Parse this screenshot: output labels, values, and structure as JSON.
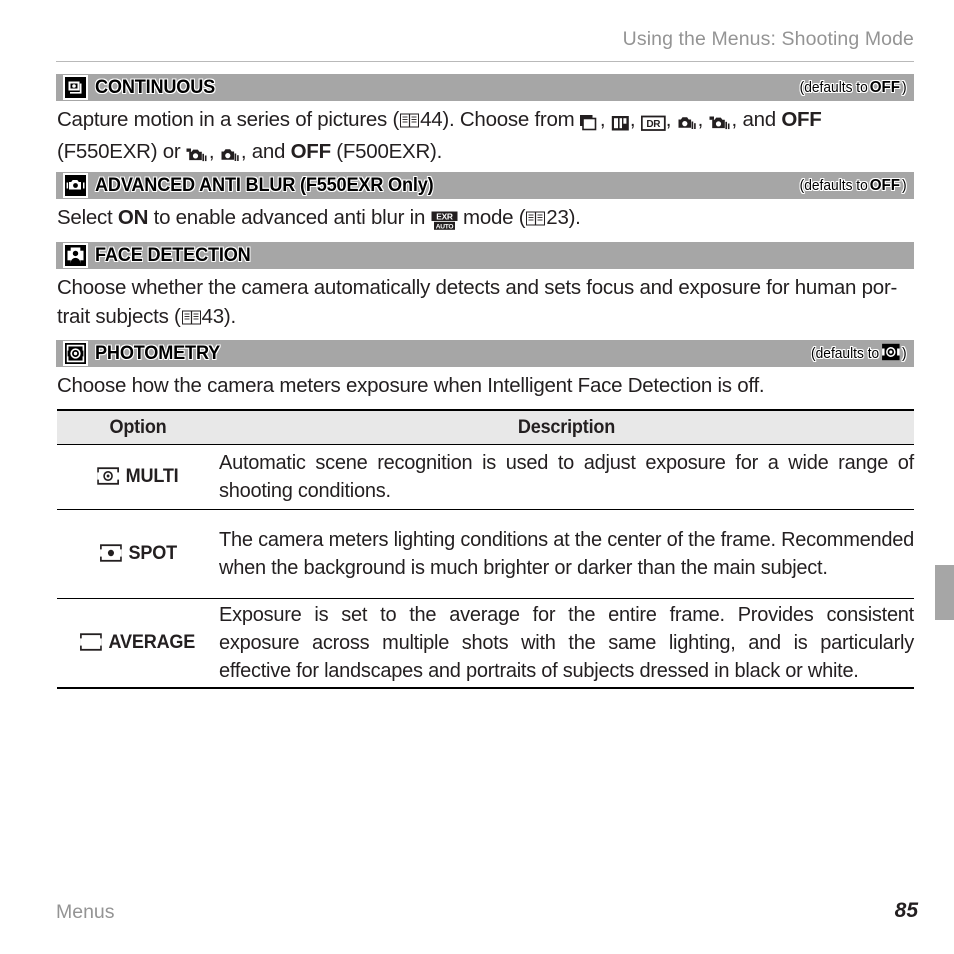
{
  "header": {
    "running_title": "Using the Menus: Shooting Mode"
  },
  "sections": [
    {
      "id": "continuous",
      "icon": "burst-camera-icon",
      "title": "CONTINUOUS",
      "defaults_prefix": "(defaults to ",
      "defaults_value": "OFF",
      "defaults_suffix": ")",
      "body_part1": "Capture motion in a series of pictures (",
      "page_ref_1": "44",
      "body_part2": "). Choose from ",
      "body_part3": ", and ",
      "bold_off_1": "OFF",
      "body_part4": " (F550EXR) or ",
      "body_part5": ", and ",
      "bold_off_2": "OFF",
      "body_part6": " (F500EXR).",
      "icons_f550": [
        "top-burst-icon",
        "best-frame-icon",
        "dr-bracketing-icon",
        "af-burst-icon",
        "motion-burst-icon"
      ],
      "icons_f500": [
        "top-burst-icon",
        "af-burst-icon"
      ]
    },
    {
      "id": "advanced-anti-blur",
      "icon": "anti-blur-camera-icon",
      "title": "ADVANCED ANTI BLUR (F550EXR Only)",
      "defaults_prefix": "(defaults to ",
      "defaults_value": "OFF",
      "defaults_suffix": ")",
      "body_part1": "Select ",
      "bold_on": "ON",
      "body_part2": " to enable advanced anti blur in ",
      "mode_icon": "exr-auto-icon",
      "body_part3": " mode (",
      "page_ref_1": "23",
      "body_part4": ")."
    },
    {
      "id": "face-detection",
      "icon": "face-detection-icon",
      "title": "FACE DETECTION",
      "body_part1": "Choose whether the camera automatically detects and sets focus and exposure for human por-trait subjects (",
      "page_ref_1": "43",
      "body_part2": ")."
    },
    {
      "id": "photometry",
      "icon": "photometry-icon",
      "title": "PHOTOMETRY",
      "defaults_prefix": "(defaults to ",
      "defaults_value_icon": "multi-metering-icon",
      "defaults_suffix": ")",
      "body_part1": "Choose how the camera meters exposure when Intelligent Face Detection is off."
    }
  ],
  "table": {
    "columns": [
      "Option",
      "Description"
    ],
    "rows": [
      {
        "icon": "multi-metering-icon",
        "option": "MULTI",
        "description": "Automatic scene recognition is used to adjust exposure for a wide range of shooting conditions."
      },
      {
        "icon": "spot-metering-icon",
        "option": "SPOT",
        "description": "The camera meters lighting conditions at the center of the frame.  Recommended when the background is much brighter or darker than the main subject."
      },
      {
        "icon": "average-metering-icon",
        "option": "AVERAGE",
        "description": "Exposure is set to the average for the entire frame.  Provides consistent exposure across multiple shots with the same lighting, and is particularly effective for landscapes and portraits of subjects dressed in black or white."
      }
    ]
  },
  "footer": {
    "chapter": "Menus",
    "page_number": "85"
  },
  "colors": {
    "section_bar": "#a6a6a6",
    "table_header": "#e8e8e8",
    "muted_text": "#949494",
    "body_text": "#231f20"
  }
}
